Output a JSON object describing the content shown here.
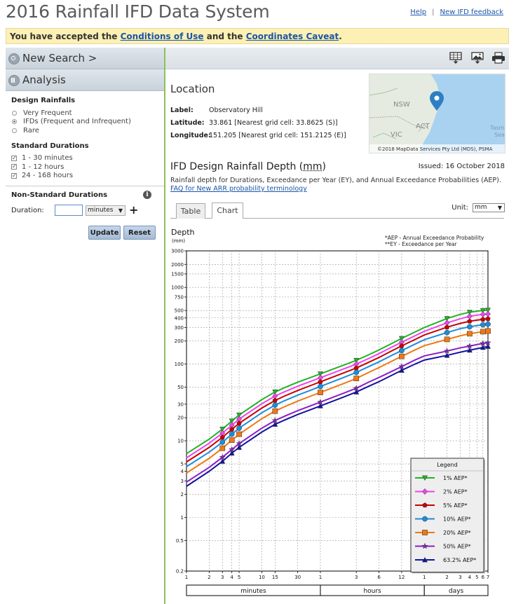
{
  "page": {
    "title": "2016 Rainfall IFD Data System",
    "help_link": "Help",
    "feedback_link": "New IFD feedback",
    "banner": {
      "prefix": "You have accepted the ",
      "conditions_link": "Conditions of Use",
      "middle": " and the ",
      "caveat_link": "Coordinates Caveat",
      "suffix": "."
    }
  },
  "sidebar": {
    "new_search": "New Search >",
    "analysis": "Analysis",
    "design_rainfalls": {
      "heading": "Design Rainfalls",
      "options": [
        {
          "label": "Very Frequent",
          "selected": false
        },
        {
          "label": "IFDs (Frequent and Infrequent)",
          "selected": true
        },
        {
          "label": "Rare",
          "selected": false
        }
      ]
    },
    "standard_durations": {
      "heading": "Standard Durations",
      "options": [
        {
          "label": "1 - 30 minutes",
          "checked": true
        },
        {
          "label": "1 - 12 hours",
          "checked": true
        },
        {
          "label": "24 - 168 hours",
          "checked": true
        }
      ]
    },
    "non_standard": {
      "heading": "Non-Standard Durations",
      "duration_label": "Duration:",
      "duration_value": "",
      "unit_selected": "minutes",
      "update_button": "Update",
      "reset_button": "Reset"
    }
  },
  "toolbar": {
    "icons": [
      "spreadsheet-download-icon",
      "image-download-icon",
      "print-icon"
    ]
  },
  "location": {
    "heading": "Location",
    "label_key": "Label:",
    "label_value": "Observatory Hill",
    "latitude_key": "Latitude:",
    "latitude_value": "33.861 [Nearest grid cell: 33.8625 (S)]",
    "longitude_key": "Longitude:",
    "longitude_value": "151.205 [Nearest grid cell: 151.2125 (E)]",
    "map": {
      "labels": [
        "NSW",
        "VIC",
        "ACT",
        "Tasm",
        "Sea"
      ],
      "attribution": "©2018 MapData Services Pty Ltd (MDS), PSMA"
    }
  },
  "ifd": {
    "title_prefix": "IFD Design Rainfall Depth (",
    "title_unit": "mm",
    "title_suffix": ")",
    "issued": "Issued: 16 October 2018",
    "description": "Rainfall depth for Durations, Exceedance per Year (EY), and Annual Exceedance Probabilities (AEP).",
    "faq_link": "FAQ for New ARR probability terminology",
    "tabs": [
      "Table",
      "Chart"
    ],
    "active_tab": "Chart",
    "unit_label": "Unit:",
    "unit_value": "mm"
  },
  "chart_data": {
    "type": "line",
    "ylabel": "Depth",
    "yunit": "(mm)",
    "yscale": "log",
    "ylim": [
      0.2,
      3000
    ],
    "y_ticks": [
      0.2,
      0.5,
      1,
      2,
      3,
      4,
      5,
      10,
      20,
      30,
      50,
      100,
      200,
      300,
      400,
      500,
      750,
      1000,
      1500,
      2000,
      3000
    ],
    "xscale": "log",
    "xlim_minutes": [
      1,
      10080
    ],
    "x_tick_labels": [
      {
        "label": "1",
        "minutes": 1
      },
      {
        "label": "2",
        "minutes": 2
      },
      {
        "label": "3",
        "minutes": 3
      },
      {
        "label": "4",
        "minutes": 4
      },
      {
        "label": "5",
        "minutes": 5
      },
      {
        "label": "10",
        "minutes": 10
      },
      {
        "label": "15",
        "minutes": 15
      },
      {
        "label": "30",
        "minutes": 30
      },
      {
        "label": "1",
        "minutes": 60
      },
      {
        "label": "3",
        "minutes": 180
      },
      {
        "label": "6",
        "minutes": 360
      },
      {
        "label": "12",
        "minutes": 720
      },
      {
        "label": "1",
        "minutes": 1440
      },
      {
        "label": "2",
        "minutes": 2880
      },
      {
        "label": "3",
        "minutes": 4320
      },
      {
        "label": "4",
        "minutes": 5760
      },
      {
        "label": "5",
        "minutes": 7200
      },
      {
        "label": "6",
        "minutes": 8640
      },
      {
        "label": "7",
        "minutes": 10080
      }
    ],
    "x_groups": [
      {
        "label": "minutes",
        "from": 1,
        "to": 60
      },
      {
        "label": "hours",
        "from": 60,
        "to": 1440
      },
      {
        "label": "days",
        "from": 1440,
        "to": 10080
      }
    ],
    "notes": [
      "*AEP - Annual Exceedance Probability",
      "**EY - Exceedance per Year"
    ],
    "legend_title": "Legend",
    "legend_position": "bottom-right",
    "grid": true,
    "marker_durations": [
      3,
      4,
      5,
      15,
      60,
      180,
      720,
      2880,
      5760,
      8640,
      10080
    ],
    "durations": [
      1,
      2,
      3,
      4,
      5,
      10,
      15,
      20,
      30,
      45,
      60,
      90,
      120,
      180,
      270,
      360,
      540,
      720,
      1080,
      1440,
      2880,
      4320,
      5760,
      7200,
      8640,
      10080
    ],
    "series": [
      {
        "name": "1% AEP*",
        "color": "#22b422",
        "marker": "triangle-down",
        "values": [
          6.8,
          10.5,
          14.2,
          18.1,
          21.7,
          34.4,
          43.3,
          49.2,
          58.1,
          67.2,
          74.6,
          86.6,
          96.2,
          112,
          134,
          153,
          187,
          216,
          262,
          300,
          393,
          445,
          475,
          490,
          500,
          505
        ]
      },
      {
        "name": "2% AEP*",
        "color": "#ee44ee",
        "marker": "diamond",
        "values": [
          6.0,
          9.3,
          12.6,
          16.0,
          19.2,
          30.4,
          38.3,
          43.5,
          51.5,
          59.8,
          66.4,
          77.2,
          85.9,
          100,
          120,
          137,
          168,
          193,
          234,
          268,
          345,
          390,
          420,
          435,
          445,
          450
        ]
      },
      {
        "name": "5% AEP*",
        "color": "#c80000",
        "marker": "pentagon",
        "values": [
          5.3,
          8.2,
          11.1,
          14.1,
          16.9,
          26.7,
          33.6,
          38.3,
          45.3,
          52.8,
          58.7,
          68.4,
          76.2,
          89,
          107,
          122,
          150,
          173,
          209,
          240,
          303,
          340,
          362,
          375,
          383,
          390
        ]
      },
      {
        "name": "10% AEP*",
        "color": "#1e8cdc",
        "marker": "circle",
        "values": [
          4.6,
          7.1,
          9.6,
          12.2,
          14.6,
          23.2,
          29.2,
          33.3,
          39.4,
          45.9,
          51.1,
          59.6,
          66.4,
          78,
          94,
          107,
          131,
          150,
          182,
          208,
          258,
          290,
          307,
          318,
          326,
          332
        ]
      },
      {
        "name": "20% AEP*",
        "color": "#f07814",
        "marker": "square",
        "values": [
          3.8,
          5.9,
          8.0,
          10.2,
          12.2,
          19.4,
          24.4,
          27.8,
          32.9,
          38.4,
          42.7,
          49.8,
          55.5,
          65,
          79,
          90,
          110,
          126,
          153,
          174,
          210,
          234,
          249,
          258,
          265,
          270
        ]
      },
      {
        "name": "50% AEP*",
        "color": "#8c1ec8",
        "marker": "star",
        "values": [
          2.9,
          4.5,
          6.1,
          7.7,
          9.2,
          14.6,
          18.4,
          20.9,
          24.7,
          28.7,
          32.0,
          37.3,
          41.5,
          48.5,
          59,
          67,
          81,
          93,
          113,
          128,
          148,
          163,
          172,
          180,
          186,
          190
        ]
      },
      {
        "name": "63.2% AEP*",
        "color": "#1414a0",
        "marker": "triangle-up",
        "values": [
          2.55,
          4.0,
          5.4,
          6.9,
          8.2,
          13.0,
          16.4,
          18.6,
          22.0,
          25.6,
          28.5,
          33.2,
          37.0,
          43.3,
          52,
          59,
          72,
          83,
          100,
          113,
          130,
          143,
          152,
          159,
          165,
          170
        ]
      }
    ]
  }
}
